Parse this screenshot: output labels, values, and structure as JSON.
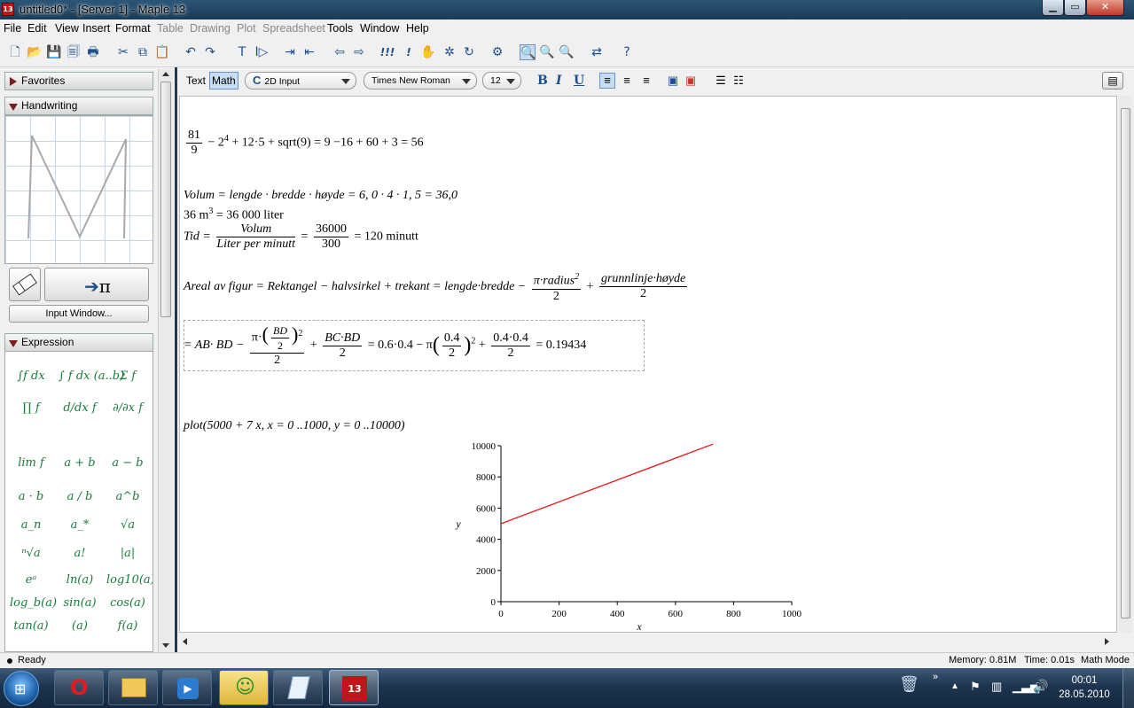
{
  "window": {
    "title": "untitled0* - [Server 1] - Maple 13",
    "icon_label": "13",
    "minimize": "▁",
    "maximize": "▭",
    "close": "✕"
  },
  "menu": [
    "File",
    "Edit",
    "View",
    "Insert",
    "Format",
    "Table",
    "Drawing",
    "Plot",
    "Spreadsheet",
    "Tools",
    "Window",
    "Help"
  ],
  "menu_disabled": [
    "Table",
    "Drawing",
    "Plot",
    "Spreadsheet"
  ],
  "toolbar_icons": [
    "new-icon",
    "open-icon",
    "save-icon",
    "print-preview-icon",
    "print-icon",
    "cut-icon",
    "copy-icon",
    "paste-icon",
    "undo-icon",
    "redo-icon",
    "text-icon",
    "math-prompt-icon",
    "indent-icon",
    "outdent-icon",
    "back-icon",
    "forward-icon",
    "execute-icon",
    "execute-all-icon",
    "stop-icon",
    "debug-icon",
    "restart-icon",
    "settings-icon",
    "zoom-100-icon",
    "zoom-150-icon",
    "zoom-200-icon",
    "toggle-icon",
    "help-icon"
  ],
  "palettes": {
    "favorites": "Favorites",
    "handwriting": "Handwriting",
    "input_window": "Input Window...",
    "expression": "Expression",
    "convert_label": "π"
  },
  "expression_items": [
    [
      "∫f dx",
      "∫ f dx (a..b)",
      "Σ f"
    ],
    [
      "∏ f",
      "d/dx f",
      "∂/∂x f"
    ],
    [
      "lim f",
      "a + b",
      "a − b"
    ],
    [
      "a · b",
      "a / b",
      "a^b"
    ],
    [
      "a_n",
      "a_*",
      "√a"
    ],
    [
      "ⁿ√a",
      "a!",
      "|a|"
    ],
    [
      "eᵃ",
      "ln(a)",
      "log10(a)"
    ],
    [
      "log_b(a)",
      "sin(a)",
      "cos(a)"
    ],
    [
      "tan(a)",
      "(a)",
      "f(a)"
    ]
  ],
  "context_bar": {
    "text_mode": "Text",
    "math_mode": "Math",
    "input_type": "2D Input",
    "font": "Times New Roman",
    "size": "12",
    "bold": "B",
    "italic": "I",
    "underline": "U"
  },
  "doc": {
    "line1": {
      "frac_n": "81",
      "frac_d": "9",
      "rest": "− 2",
      "exp": "4",
      "rest2": "+ 12·5 + sqrt(9) = 9 −16 + 60 + 3 = 56"
    },
    "line2": "Volum = lengde · bredde · høyde =  6, 0 · 4 · 1, 5 = 36,0",
    "line3a": "36 m",
    "line3_exp": "3",
    "line3b": " = 36 000 liter",
    "line4": {
      "lhs": "Tid =",
      "f1n": "Volum",
      "f1d": "Liter per minutt",
      "eq": "=",
      "f2n": "36000",
      "f2d": "300",
      "rhs": "= 120 minutt"
    },
    "line5": {
      "lhs": "Areal av figur = Rektangel − halvsirkel + trekant =  lengde·bredde −",
      "f1n": "π·radius",
      "f1_exp": "2",
      "f1d": "2",
      "plus": "+",
      "f2n": "grunnlinje·høyde",
      "f2d": "2"
    },
    "line6": {
      "a": "= AB· BD −",
      "f1n_pre": "π·",
      "bd": "BD",
      "two": "2",
      "exp": "2",
      "f1d": "2",
      "plus": "+",
      "f2n": "BC·BD",
      "f2d": "2",
      "b": "= 0.6·0.4 − π",
      "c": "0.4",
      "d": "2",
      "plus2": "+",
      "f3n": "0.4·0.4",
      "f3d": "2",
      "result": "= 0.19434"
    },
    "plot_cmd": "plot(5000 + 7 x, x = 0 ..1000, y = 0 ..10000)"
  },
  "chart_data": {
    "type": "line",
    "series": [
      {
        "x": [
          0,
          730
        ],
        "y": [
          5000,
          10110
        ],
        "color": "#e31a1c"
      }
    ],
    "xlabel": "x",
    "ylabel": "y",
    "xlim": [
      0,
      1000
    ],
    "ylim": [
      0,
      10000
    ],
    "xticks": [
      0,
      200,
      400,
      600,
      800,
      1000
    ],
    "yticks": [
      0,
      2000,
      4000,
      6000,
      8000,
      10000
    ],
    "grid": false
  },
  "status": {
    "ready": "Ready",
    "memory": "Memory: 0.81M",
    "time": "Time: 0.01s",
    "mode": "Math Mode"
  },
  "taskbar": {
    "time": "00:01",
    "date": "28.05.2010",
    "maple_label": "13"
  }
}
